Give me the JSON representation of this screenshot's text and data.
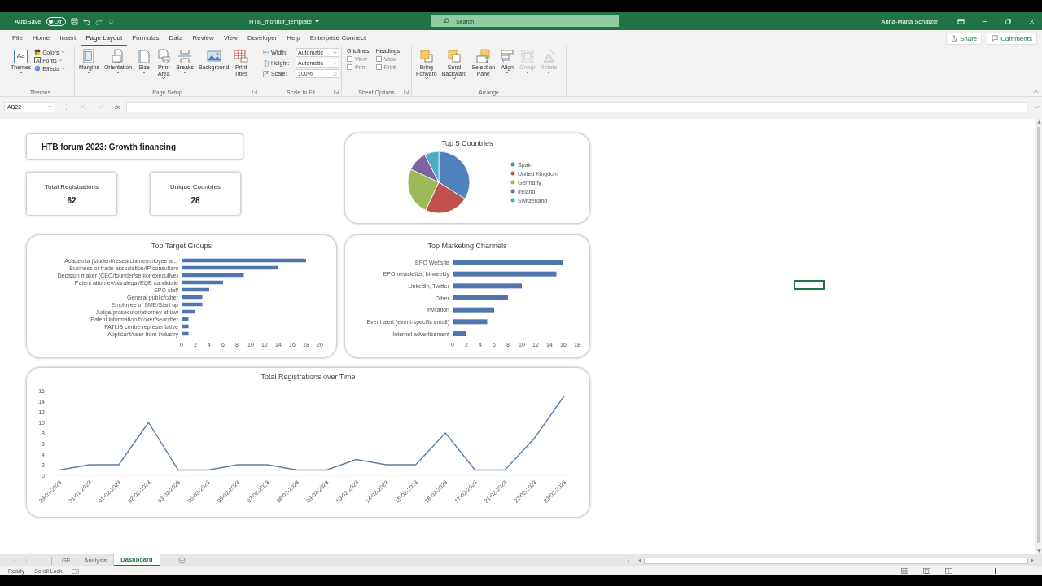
{
  "title_bar": {
    "autosave_label": "AutoSave",
    "autosave": {
      "label": "Off",
      "on": false
    },
    "file_name": "HTB_monitor_template",
    "search_placeholder": "Search",
    "user": "Anna-Maria Schätzle"
  },
  "menu_tabs": [
    {
      "label": "File",
      "selected": false
    },
    {
      "label": "Home",
      "selected": false
    },
    {
      "label": "Insert",
      "selected": false
    },
    {
      "label": "Page Layout",
      "selected": true
    },
    {
      "label": "Formulas",
      "selected": false
    },
    {
      "label": "Data",
      "selected": false
    },
    {
      "label": "Review",
      "selected": false
    },
    {
      "label": "View",
      "selected": false
    },
    {
      "label": "Developer",
      "selected": false
    },
    {
      "label": "Help",
      "selected": false
    },
    {
      "label": "Enterprise Connect",
      "selected": false
    }
  ],
  "share": "Share",
  "comments": "Comments",
  "ribbon": [
    {
      "kind": "themes",
      "label": "Themes",
      "launcher": false,
      "button": {
        "label": "Themes",
        "glyph": "Aa"
      },
      "items": [
        {
          "label": "Colors"
        },
        {
          "label": "Fonts",
          "glyph": "A"
        },
        {
          "label": "Effects"
        }
      ]
    },
    {
      "kind": "buttons",
      "label": "Page Setup",
      "launcher": true,
      "buttons": [
        {
          "label": "Margins",
          "dropdown": true,
          "disabled": false
        },
        {
          "label": "Orientation",
          "dropdown": true,
          "disabled": false
        },
        {
          "label": "Size",
          "dropdown": true,
          "disabled": false
        },
        {
          "label": "Print Area",
          "dropdown": true,
          "disabled": false
        },
        {
          "label": "Breaks",
          "dropdown": true,
          "disabled": false
        },
        {
          "label": "Background",
          "dropdown": false,
          "disabled": false
        },
        {
          "label": "Print Titles",
          "dropdown": false,
          "disabled": false
        }
      ]
    },
    {
      "kind": "scale",
      "label": "Scale to Fit",
      "launcher": true,
      "rows": [
        {
          "kind": "dropdown",
          "label": "Width:",
          "value": "Automatic"
        },
        {
          "kind": "dropdown",
          "label": "Height:",
          "value": "Automatic"
        },
        {
          "kind": "spinner",
          "label": "Scale:",
          "value": "100%"
        }
      ]
    },
    {
      "kind": "sheet_options",
      "label": "Sheet Options",
      "launcher": true,
      "columns": [
        {
          "heading": "Gridlines",
          "options": [
            {
              "label": "View",
              "checked": false
            },
            {
              "label": "Print",
              "checked": false
            }
          ]
        },
        {
          "heading": "Headings",
          "options": [
            {
              "label": "View",
              "checked": false
            },
            {
              "label": "Print",
              "checked": false
            }
          ]
        }
      ]
    },
    {
      "kind": "buttons",
      "label": "Arrange",
      "launcher": false,
      "buttons": [
        {
          "label": "Bring Forward",
          "dropdown": true,
          "disabled": false
        },
        {
          "label": "Send Backward",
          "dropdown": true,
          "disabled": false
        },
        {
          "label": "Selection Pane",
          "dropdown": false,
          "disabled": false
        },
        {
          "label": "Align",
          "dropdown": true,
          "disabled": false
        },
        {
          "label": "Group",
          "dropdown": true,
          "disabled": true
        },
        {
          "label": "Rotate",
          "dropdown": true,
          "disabled": true
        }
      ]
    }
  ],
  "formula_bar": {
    "name_box": "AB22",
    "function_label": "fx"
  },
  "dashboard": {
    "title": "HTB forum 2023: Growth financing",
    "kpis": [
      {
        "label": "Total Registrations",
        "value": "62"
      },
      {
        "label": "Unique Countries",
        "value": "28"
      }
    ],
    "countries": {
      "title": "Top 5 Countries",
      "legend": [
        {
          "label": "Spain",
          "color": "#4f81bd"
        },
        {
          "label": "United Kingdom",
          "color": "#c0504d"
        },
        {
          "label": "Germany",
          "color": "#9bbb59"
        },
        {
          "label": "Ireland",
          "color": "#8064a2"
        },
        {
          "label": "Switzerland",
          "color": "#4bacc6"
        }
      ]
    },
    "bar_charts": [
      {
        "chart_data": {
          "type": "bar",
          "orientation": "horizontal",
          "title": "Top Target Groups",
          "categories": [
            "Academia (student/researcher/employee at...",
            "Business or trade association/IP consultant",
            "Decision maker (CEO/founder/senior executive)",
            "Patent attorney/paralegal/EQE candidate",
            "EPO staff",
            "General public/other",
            "Employee of SME/Start up",
            "Judge/prosecutor/attorney at law",
            "Patent information broker/searcher",
            "PATLIB centre representative",
            "Applicant/user from industry"
          ],
          "values": [
            18,
            14,
            9,
            6,
            4,
            3,
            3,
            2,
            1,
            1,
            1
          ],
          "xlim": [
            0,
            20
          ],
          "xticks": [
            0,
            2,
            4,
            6,
            8,
            10,
            12,
            14,
            16,
            18,
            20
          ]
        }
      },
      {
        "chart_data": {
          "type": "bar",
          "orientation": "horizontal",
          "title": "Top Marketing Channels",
          "categories": [
            "EPO Website",
            "EPO newsletter, bi-weekly",
            "LinkedIn, Twitter",
            "Other",
            "Invitation",
            "Event alert (event-specific email)",
            "Internet advertisement"
          ],
          "values": [
            16,
            15,
            10,
            8,
            6,
            5,
            2
          ],
          "xlim": [
            0,
            18
          ],
          "xticks": [
            0,
            2,
            4,
            6,
            8,
            10,
            12,
            14,
            16,
            18
          ]
        }
      }
    ],
    "registrations": {
      "chart_data": {
        "type": "line",
        "title": "Total Registrations over Time",
        "categories": [
          "29-01-2023",
          "31-01-2023",
          "01-02-2023",
          "02-02-2023",
          "03-02-2023",
          "05-02-2023",
          "06-02-2023",
          "07-02-2023",
          "08-02-2023",
          "09-02-2023",
          "10-02-2023",
          "14-02-2023",
          "15-02-2023",
          "16-02-2023",
          "17-02-2023",
          "21-02-2023",
          "22-02-2023",
          "23-02-2023"
        ],
        "values": [
          1,
          2,
          2,
          10,
          1,
          1,
          2,
          2,
          1,
          1,
          3,
          2,
          2,
          8,
          1,
          1,
          7,
          15
        ],
        "ylim": [
          0,
          16
        ],
        "yticks": [
          0,
          2,
          4,
          6,
          8,
          10,
          12,
          14,
          16
        ]
      }
    }
  },
  "sheet_tabs": [
    {
      "label": "GF",
      "selected": false
    },
    {
      "label": "Analysis",
      "selected": false
    },
    {
      "label": "Dashboard",
      "selected": true
    }
  ],
  "status": [
    "Ready",
    "Scroll Lock"
  ],
  "zoom": {
    "level": 0.5
  }
}
